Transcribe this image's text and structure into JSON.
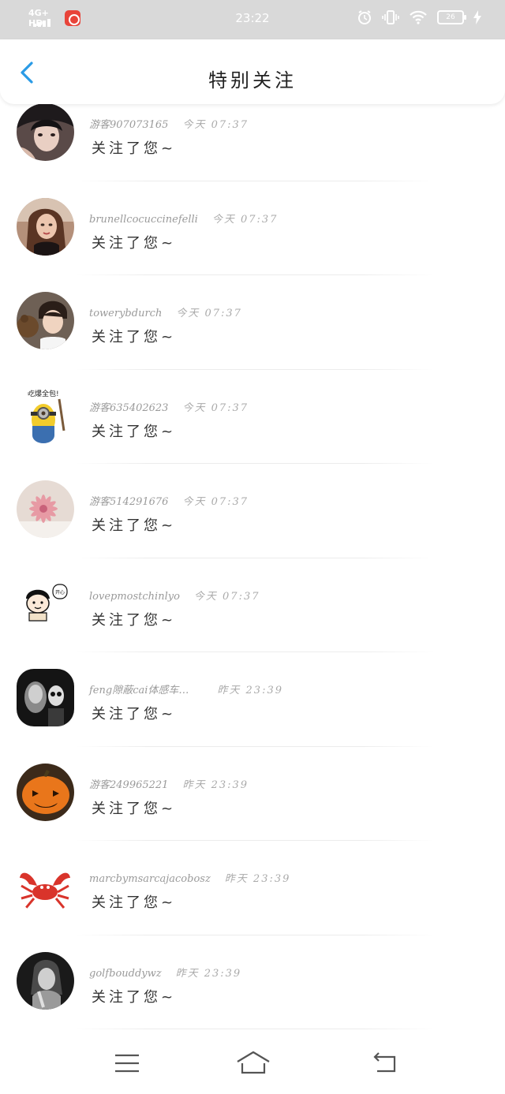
{
  "status_bar": {
    "network": "4G+ HD",
    "time": "23:22",
    "battery": "26"
  },
  "header": {
    "title": "特别关注"
  },
  "items": [
    {
      "name": "游客907073165",
      "time": "今天 07:37",
      "message": "关注了您~"
    },
    {
      "name": "brunellcocuccinefelli",
      "time": "今天 07:37",
      "message": "关注了您~"
    },
    {
      "name": "towerybdurch",
      "time": "今天 07:37",
      "message": "关注了您~"
    },
    {
      "name": "游客635402623",
      "time": "今天 07:37",
      "message": "关注了您~"
    },
    {
      "name": "游客514291676",
      "time": "今天 07:37",
      "message": "关注了您~"
    },
    {
      "name": "lovepmostchinlyo",
      "time": "今天 07:37",
      "message": "关注了您~"
    },
    {
      "name": "feng隙蔽cai体感车…",
      "time": "昨天 23:39",
      "message": "关注了您~"
    },
    {
      "name": "游客249965221",
      "time": "昨天 23:39",
      "message": "关注了您~"
    },
    {
      "name": "marcbymsarcajacobosz",
      "time": "昨天 23:39",
      "message": "关注了您~"
    },
    {
      "name": "golfbouddywz",
      "time": "昨天 23:39",
      "message": "关注了您~"
    }
  ],
  "avatar_badge_text": "吃爆全包!",
  "avatar_bubble_text": "开心",
  "icons": {
    "back": "chevron-left-icon",
    "menu": "menu-icon",
    "home": "home-icon",
    "return": "return-icon"
  },
  "colors": {
    "accent": "#2a9be6",
    "status_bar_bg": "#d9d9d9",
    "meta_text": "#9a9a9a"
  }
}
